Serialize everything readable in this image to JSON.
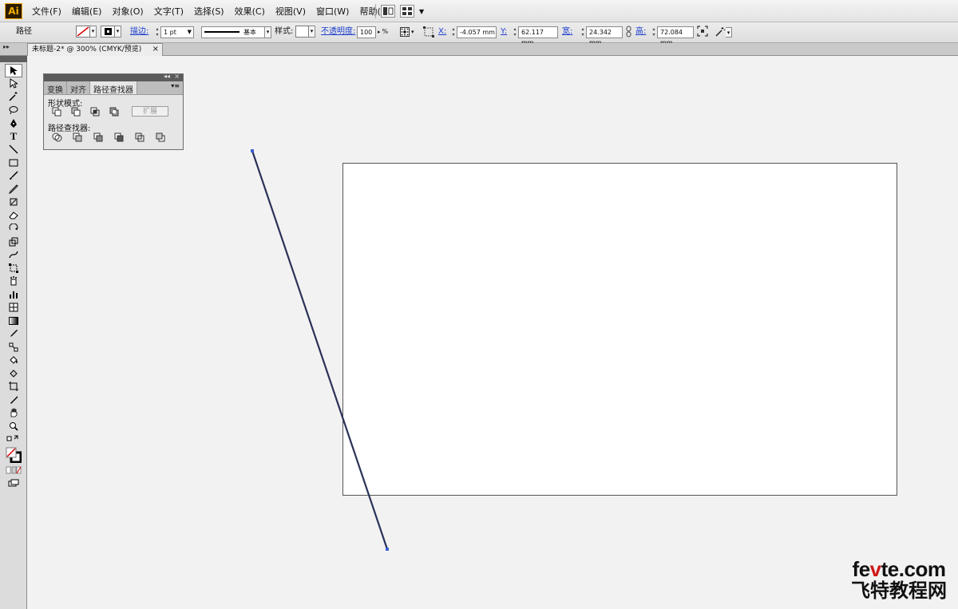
{
  "app": {
    "logo": "Ai"
  },
  "menu": [
    "文件(F)",
    "编辑(E)",
    "对象(O)",
    "文字(T)",
    "选择(S)",
    "效果(C)",
    "视图(V)",
    "窗口(W)",
    "帮助(H)"
  ],
  "control_bar": {
    "selection_label": "路径",
    "stroke_label": "描边:",
    "stroke_weight": "1 pt",
    "brush_label": "基本",
    "style_label": "样式:",
    "opacity_label": "不透明度:",
    "opacity_value": "100",
    "opacity_unit": "%",
    "x_label": "X:",
    "x_value": "-4.057 mm",
    "y_label": "Y:",
    "y_value": "62.117 mm",
    "w_label": "宽:",
    "w_value": "24.342 mm",
    "h_label": "高:",
    "h_value": "72.084 mm"
  },
  "document_tab": {
    "title": "未标题-2* @ 300% (CMYK/预览)",
    "close": "×"
  },
  "pathfinder_panel": {
    "tabs": [
      "变换",
      "对齐",
      "路径查找器"
    ],
    "active_tab": 2,
    "shape_modes_label": "形状模式:",
    "pathfinders_label": "路径查找器:",
    "expand_label": "扩展",
    "collapse": "◂◂",
    "close": "×",
    "menu": "▾≡"
  },
  "toolbox_grip": "▸▸",
  "watermark": {
    "line1_a": "fe",
    "line1_v": "v",
    "line1_b": "te.com",
    "line2": "飞特教程网"
  },
  "colors": {
    "stroke_line": "#2a3258",
    "accent_link": "#1f3fd0"
  }
}
